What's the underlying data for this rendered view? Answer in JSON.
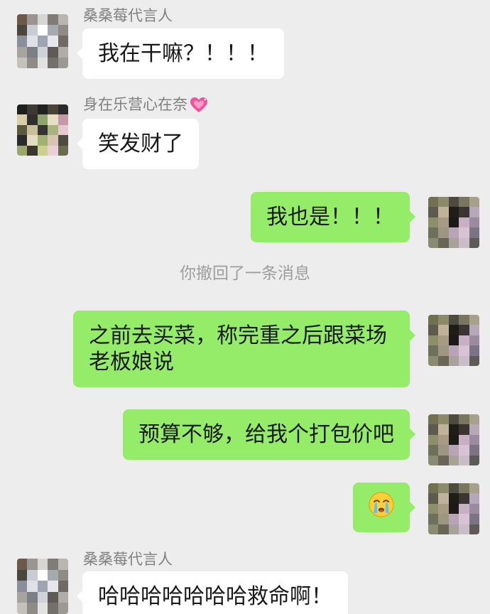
{
  "theme": {
    "background": "#EDEDED",
    "self_bubble": "#95EC69",
    "other_bubble": "#FFFFFF",
    "text": "#191919",
    "name_text": "#808080",
    "system_text": "#9E9E9E"
  },
  "messages": [
    {
      "type": "text",
      "from_self": false,
      "sender": "桑桑莓代言人",
      "text": "我在干嘛？！！！"
    },
    {
      "type": "text",
      "from_self": false,
      "sender": "身在乐营心在奈",
      "sender_icon": "sparkling-heart-icon",
      "text": "笑发财了"
    },
    {
      "type": "text",
      "from_self": true,
      "text": "我也是！！！"
    },
    {
      "type": "system",
      "text": "你撤回了一条消息"
    },
    {
      "type": "text",
      "from_self": true,
      "text": "之前去买菜，称完重之后跟菜场老板娘说"
    },
    {
      "type": "text",
      "from_self": true,
      "text": "预算不够，给我个打包价吧"
    },
    {
      "type": "emoji",
      "from_self": true,
      "icon": "crying-face-emoji-icon"
    },
    {
      "type": "text",
      "from_self": false,
      "sender": "桑桑莓代言人",
      "text": "哈哈哈哈哈哈哈救命啊！"
    }
  ]
}
